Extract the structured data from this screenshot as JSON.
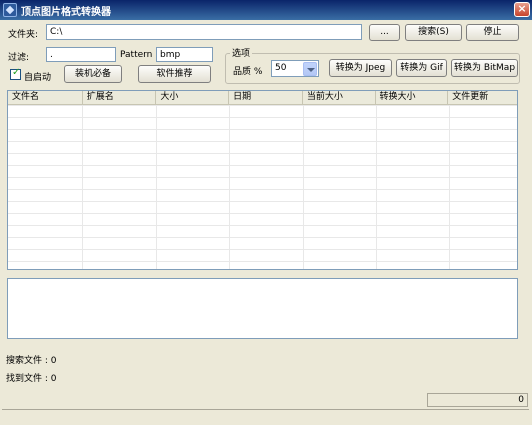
{
  "window": {
    "title": "顶点图片格式转换器",
    "close": "×"
  },
  "folder": {
    "label": "文件夹:",
    "value": "C:\\"
  },
  "buttons": {
    "browse": "...",
    "search": "搜索(S)",
    "stop": "停止",
    "install": "装机必备",
    "recommend": "软件推荐"
  },
  "filter": {
    "label": "过滤:",
    "value": ".",
    "pattern_label": "Pattern",
    "pattern_value": "bmp"
  },
  "autostart": {
    "label": "自启动",
    "checked": true
  },
  "options": {
    "title": "选项",
    "quality_label": "品质 %",
    "quality_value": "50",
    "to_jpeg": "转换为 Jpeg",
    "to_gif": "转换为 Gif",
    "to_bitmap": "转换为 BitMap"
  },
  "table": {
    "columns": [
      "文件名",
      "扩展名",
      "大小",
      "日期",
      "当前大小",
      "转换大小",
      "文件更新"
    ]
  },
  "status": {
    "searched": "搜索文件 : 0",
    "found": "找到文件 : 0",
    "progress": "0"
  }
}
